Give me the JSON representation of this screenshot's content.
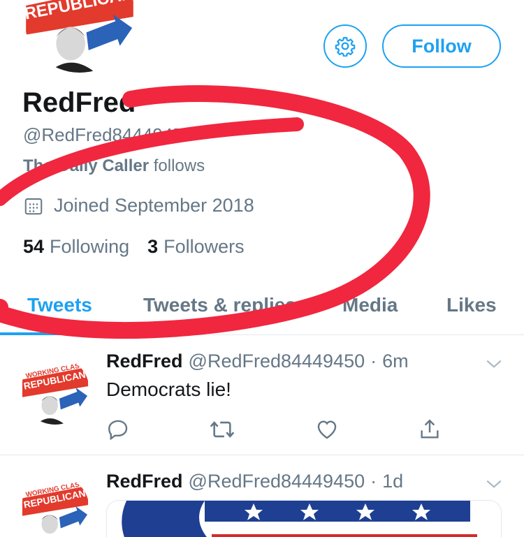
{
  "profile": {
    "badge_top": "WORKING CLASS",
    "badge_main": "REPUBLICAN",
    "name": "RedFred",
    "handle": "@RedFred84449450",
    "follows_by": "The Daily Caller",
    "follows_suffix": "follows",
    "joined": "Joined September 2018",
    "following_count": "54",
    "following_label": "Following",
    "followers_count": "3",
    "followers_label": "Followers"
  },
  "buttons": {
    "follow_label": "Follow",
    "settings_icon": "gear-icon"
  },
  "tabs": [
    {
      "label": "Tweets",
      "active": true
    },
    {
      "label": "Tweets & replies",
      "active": false
    },
    {
      "label": "Media",
      "active": false
    },
    {
      "label": "Likes",
      "active": false
    }
  ],
  "tweets": [
    {
      "name": "RedFred",
      "handle": "@RedFred84449450",
      "dot": "·",
      "time": "6m",
      "text": "Democrats lie!"
    },
    {
      "name": "RedFred",
      "handle": "@RedFred84449450",
      "dot": "·",
      "time": "1d",
      "text": ""
    }
  ],
  "colors": {
    "accent": "#1da1f2",
    "secondary_text": "#657786",
    "annotation": "#f0273f",
    "badge_red": "#e23a2c",
    "badge_blue": "#2a63b8"
  }
}
